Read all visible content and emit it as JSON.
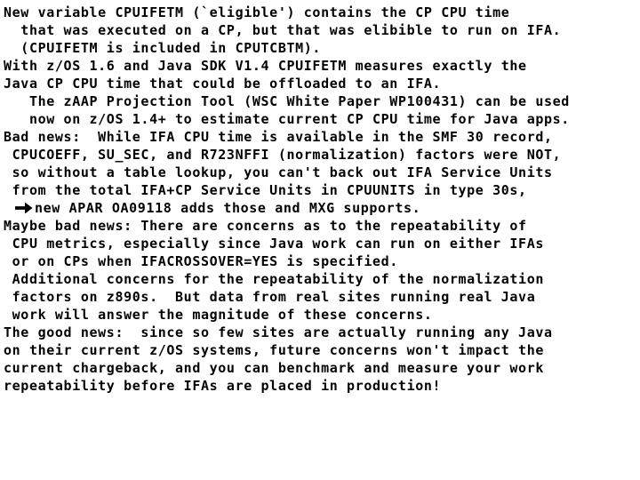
{
  "slide": {
    "background_color": "#ffffff",
    "text_color": "#000000",
    "body_lines": [
      {
        "id": "l1",
        "text": "New variable CPUIFETM (`eligible') contains the CP CPU time"
      },
      {
        "id": "l2",
        "text": "  that was executed on a CP, but that was elibible to run on IFA."
      },
      {
        "id": "l3",
        "text": "  (CPUIFETM is included in CPUTCBTM)."
      },
      {
        "id": "l4",
        "text": "With z/OS 1.6 and Java SDK V1.4 CPUIFETM measures exactly the"
      },
      {
        "id": "l5",
        "text": "Java CP CPU time that could be offloaded to an IFA."
      },
      {
        "id": "l6",
        "text": "   The zAAP Projection Tool (WSC White Paper WP100431) can be used"
      },
      {
        "id": "l7",
        "text": "   now on z/OS 1.4+ to estimate current CP CPU time for Java apps."
      },
      {
        "id": "l8",
        "text": "Bad news:  While IFA CPU time is available in the SMF 30 record,"
      },
      {
        "id": "l9",
        "text": " CPUCOEFF, SU_SEC, and R723NFFI (normalization) factors were NOT,"
      },
      {
        "id": "l10",
        "text": " so without a table lookup, you can't back out IFA Service Units"
      },
      {
        "id": "l11",
        "text": " from the total IFA+CP Service Units in CPUUNITS in type 30s,"
      },
      {
        "id": "l12",
        "text": "ARROW_LINE",
        "arrow_icon": "right-arrow-icon",
        "arrow_text": "new APAR OA09118 adds those and MXG supports."
      },
      {
        "id": "l13",
        "text": "Maybe bad news: There are concerns as to the repeatability of"
      },
      {
        "id": "l14",
        "text": " CPU metrics, especially since Java work can run on either IFAs"
      },
      {
        "id": "l15",
        "text": " or on CPs when IFACROSSOVER=YES is specified."
      },
      {
        "id": "l16",
        "text": " Additional concerns for the repeatability of the normalization"
      },
      {
        "id": "l17",
        "text": " factors on z890s.  But data from real sites running real Java"
      },
      {
        "id": "l18",
        "text": " work will answer the magnitude of these concerns."
      },
      {
        "id": "l19",
        "text": "The good news:  since so few sites are actually running any Java"
      },
      {
        "id": "l20",
        "text": "on their current z/OS systems, future concerns won't impact the"
      },
      {
        "id": "l21",
        "text": "current chargeback, and you can benchmark and measure your work"
      },
      {
        "id": "l22",
        "text": "repeatability before IFAs are placed in production!"
      }
    ]
  }
}
